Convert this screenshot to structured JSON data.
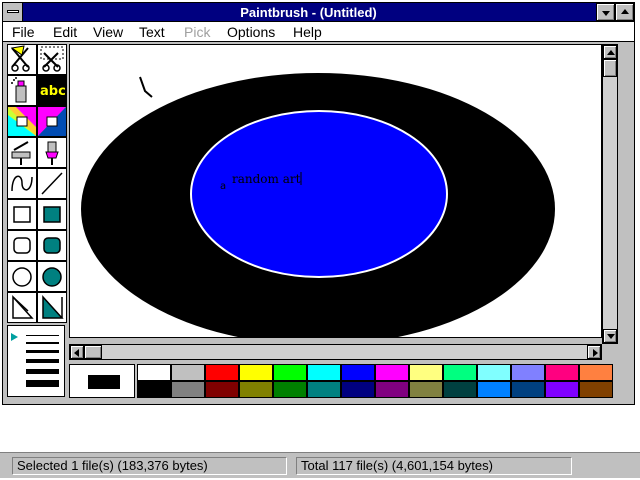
{
  "window": {
    "title": "Paintbrush - (Untitled)"
  },
  "menu": [
    {
      "label": "File",
      "disabled": false
    },
    {
      "label": "Edit",
      "disabled": false
    },
    {
      "label": "View",
      "disabled": false
    },
    {
      "label": "Text",
      "disabled": false
    },
    {
      "label": "Pick",
      "disabled": true
    },
    {
      "label": "Options",
      "disabled": false
    },
    {
      "label": "Help",
      "disabled": false
    }
  ],
  "tools": [
    {
      "name": "scissors-icon"
    },
    {
      "name": "pick-scissors-icon"
    },
    {
      "name": "airbrush-icon"
    },
    {
      "name": "text-tool-icon",
      "label": "abc",
      "selected": true
    },
    {
      "name": "color-eraser-icon"
    },
    {
      "name": "eraser-icon"
    },
    {
      "name": "paint-roller-icon"
    },
    {
      "name": "brush-icon"
    },
    {
      "name": "curve-icon"
    },
    {
      "name": "line-icon"
    },
    {
      "name": "box-icon"
    },
    {
      "name": "filled-box-icon"
    },
    {
      "name": "rounded-box-icon"
    },
    {
      "name": "filled-rounded-box-icon"
    },
    {
      "name": "circle-icon"
    },
    {
      "name": "filled-circle-icon"
    },
    {
      "name": "polygon-icon"
    },
    {
      "name": "filled-polygon-icon"
    }
  ],
  "canvas": {
    "typed_text": "random art",
    "stray_char": "a",
    "outer_ellipse_color": "#000000",
    "inner_ellipse_color": "#0000ff",
    "inner_outline_color": "#ffffff"
  },
  "palette": {
    "foreground": "#000000",
    "background": "#ffffff",
    "top_row": [
      "#ffffff",
      "#c0c0c0",
      "#ff0000",
      "#ffff00",
      "#00ff00",
      "#00ffff",
      "#0000ff",
      "#ff00ff",
      "#ffff80",
      "#00ff80",
      "#80ffff",
      "#8080ff",
      "#ff0080",
      "#ff8040"
    ],
    "bottom_row": [
      "#000000",
      "#808080",
      "#800000",
      "#808000",
      "#008000",
      "#008080",
      "#000080",
      "#800080",
      "#808040",
      "#004040",
      "#0080ff",
      "#004080",
      "#8000ff",
      "#804000"
    ]
  },
  "status": {
    "left": "Selected 1 file(s) (183,376 bytes)",
    "right": "Total 117 file(s) (4,601,154 bytes)"
  },
  "accent": "#000080"
}
